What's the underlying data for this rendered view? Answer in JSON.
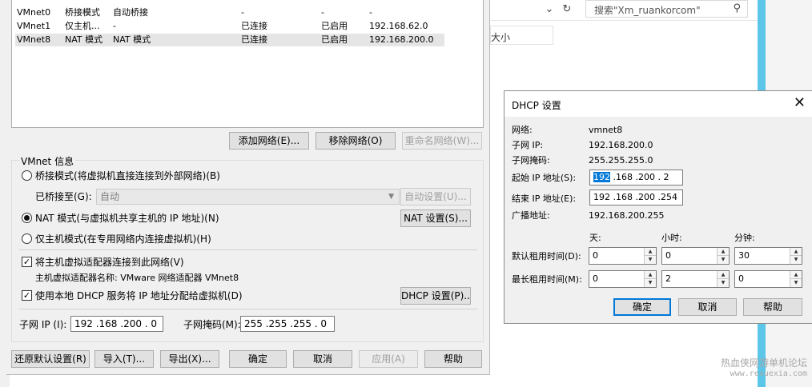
{
  "background": {
    "back_icon": "chevron-down-icon",
    "refresh_icon": "refresh-icon",
    "search_placeholder": "搜索\"Xm_ruankorcom\"",
    "search_icon": "search-icon",
    "size_column": "大小",
    "watermark_line1": "热血侠网游单机论坛",
    "watermark_line2": "www.rexuexia.com"
  },
  "vmnet_list": [
    {
      "name": "VMnet0",
      "type": "桥接模式",
      "external": "自动桥接",
      "host": "-",
      "dhcp": "-",
      "subnet": "-"
    },
    {
      "name": "VMnet1",
      "type": "仅主机...",
      "external": "-",
      "host": "已连接",
      "dhcp": "已启用",
      "subnet": "192.168.62.0"
    },
    {
      "name": "VMnet8",
      "type": "NAT 模式",
      "external": "NAT 模式",
      "host": "已连接",
      "dhcp": "已启用",
      "subnet": "192.168.200.0"
    }
  ],
  "list_buttons": {
    "add": "添加网络(E)...",
    "remove": "移除网络(O)",
    "rename": "重命名网络(W)..."
  },
  "vmnet_info": {
    "title": "VMnet 信息",
    "bridge_mode": "桥接模式(将虚拟机直接连接到外部网络)(B)",
    "bridged_to_label": "已桥接至(G):",
    "bridged_to_value": "自动",
    "auto_settings": "自动设置(U)...",
    "nat_mode": "NAT 模式(与虚拟机共享主机的 IP 地址)(N)",
    "nat_settings": "NAT 设置(S)...",
    "host_only": "仅主机模式(在专用网络内连接虚拟机)(H)",
    "connect_adapter": "将主机虚拟适配器连接到此网络(V)",
    "adapter_name": "主机虚拟适配器名称: VMware 网络适配器 VMnet8",
    "use_dhcp": "使用本地 DHCP 服务将 IP 地址分配给虚拟机(D)",
    "dhcp_settings": "DHCP 设置(P)...",
    "subnet_ip_label": "子网 IP (I):",
    "subnet_ip_value": "192 .168 .200 . 0",
    "subnet_mask_label": "子网掩码(M):",
    "subnet_mask_value": "255 .255 .255 . 0",
    "check_mark": "✓"
  },
  "bottom_buttons": {
    "restore": "还原默认设置(R)",
    "import": "导入(T)...",
    "export": "导出(X)...",
    "ok": "确定",
    "cancel": "取消",
    "apply": "应用(A)",
    "help": "帮助"
  },
  "dhcp": {
    "title": "DHCP 设置",
    "close_icon": "close-icon",
    "network_label": "网络:",
    "network_value": "vmnet8",
    "subnet_ip_label": "子网 IP:",
    "subnet_ip_value": "192.168.200.0",
    "subnet_mask_label": "子网掩码:",
    "subnet_mask_value": "255.255.255.0",
    "start_ip_label": "起始 IP 地址(S):",
    "start_ip_selected": "192",
    "start_ip_rest": " .168 .200 . 2",
    "end_ip_label": "结束 IP 地址(E):",
    "end_ip_value": "192 .168 .200 .254",
    "broadcast_label": "广播地址:",
    "broadcast_value": "192.168.200.255",
    "days_label": "天:",
    "hours_label": "小时:",
    "minutes_label": "分钟:",
    "default_lease_label": "默认租用时间(D):",
    "default_lease": {
      "days": "0",
      "hours": "0",
      "minutes": "30"
    },
    "max_lease_label": "最长租用时间(M):",
    "max_lease": {
      "days": "0",
      "hours": "2",
      "minutes": "0"
    },
    "ok": "确定",
    "cancel": "取消",
    "help": "帮助"
  }
}
